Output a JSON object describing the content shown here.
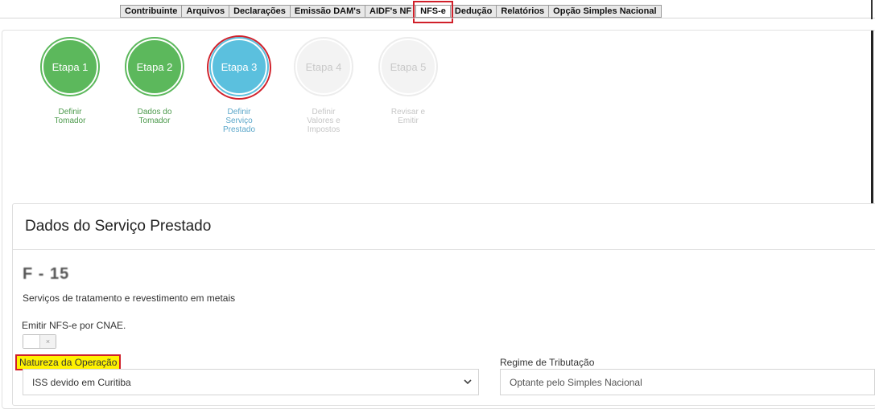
{
  "menu": {
    "items": [
      "Contribuinte",
      "Arquivos",
      "Declarações",
      "Emissão DAM's",
      "AIDF's NF",
      "NFS-e",
      "Dedução",
      "Relatórios",
      "Opção Simples Nacional"
    ],
    "active": "NFS-e"
  },
  "steps": [
    {
      "circle": "Etapa 1",
      "label": [
        "Definir",
        "Tomador"
      ],
      "state": "done"
    },
    {
      "circle": "Etapa 2",
      "label": [
        "Dados do",
        "Tomador"
      ],
      "state": "done"
    },
    {
      "circle": "Etapa 3",
      "label": [
        "Definir",
        "Serviço",
        "Prestado"
      ],
      "state": "current"
    },
    {
      "circle": "Etapa 4",
      "label": [
        "Definir",
        "Valores e",
        "Impostos"
      ],
      "state": "todo"
    },
    {
      "circle": "Etapa 5",
      "label": [
        "Revisar e",
        "Emitir"
      ],
      "state": "todo"
    }
  ],
  "panel": {
    "title": "Dados do Serviço Prestado",
    "code": "F - 15",
    "description": "Serviços de tratamento e revestimento em metais",
    "cnae_label": "Emitir NFS-e por CNAE.",
    "toggle_off_icon": "×",
    "natureza_label": "Natureza da Operação",
    "natureza_value": "ISS devido em Curitiba",
    "regime_label": "Regime de Tributação",
    "regime_value": "Optante pelo Simples Nacional"
  },
  "colors": {
    "done": "#5cb85c",
    "current": "#5bc0de",
    "todo": "#f3f3f3",
    "highlight": "#d0202a",
    "marker": "#fff200"
  }
}
